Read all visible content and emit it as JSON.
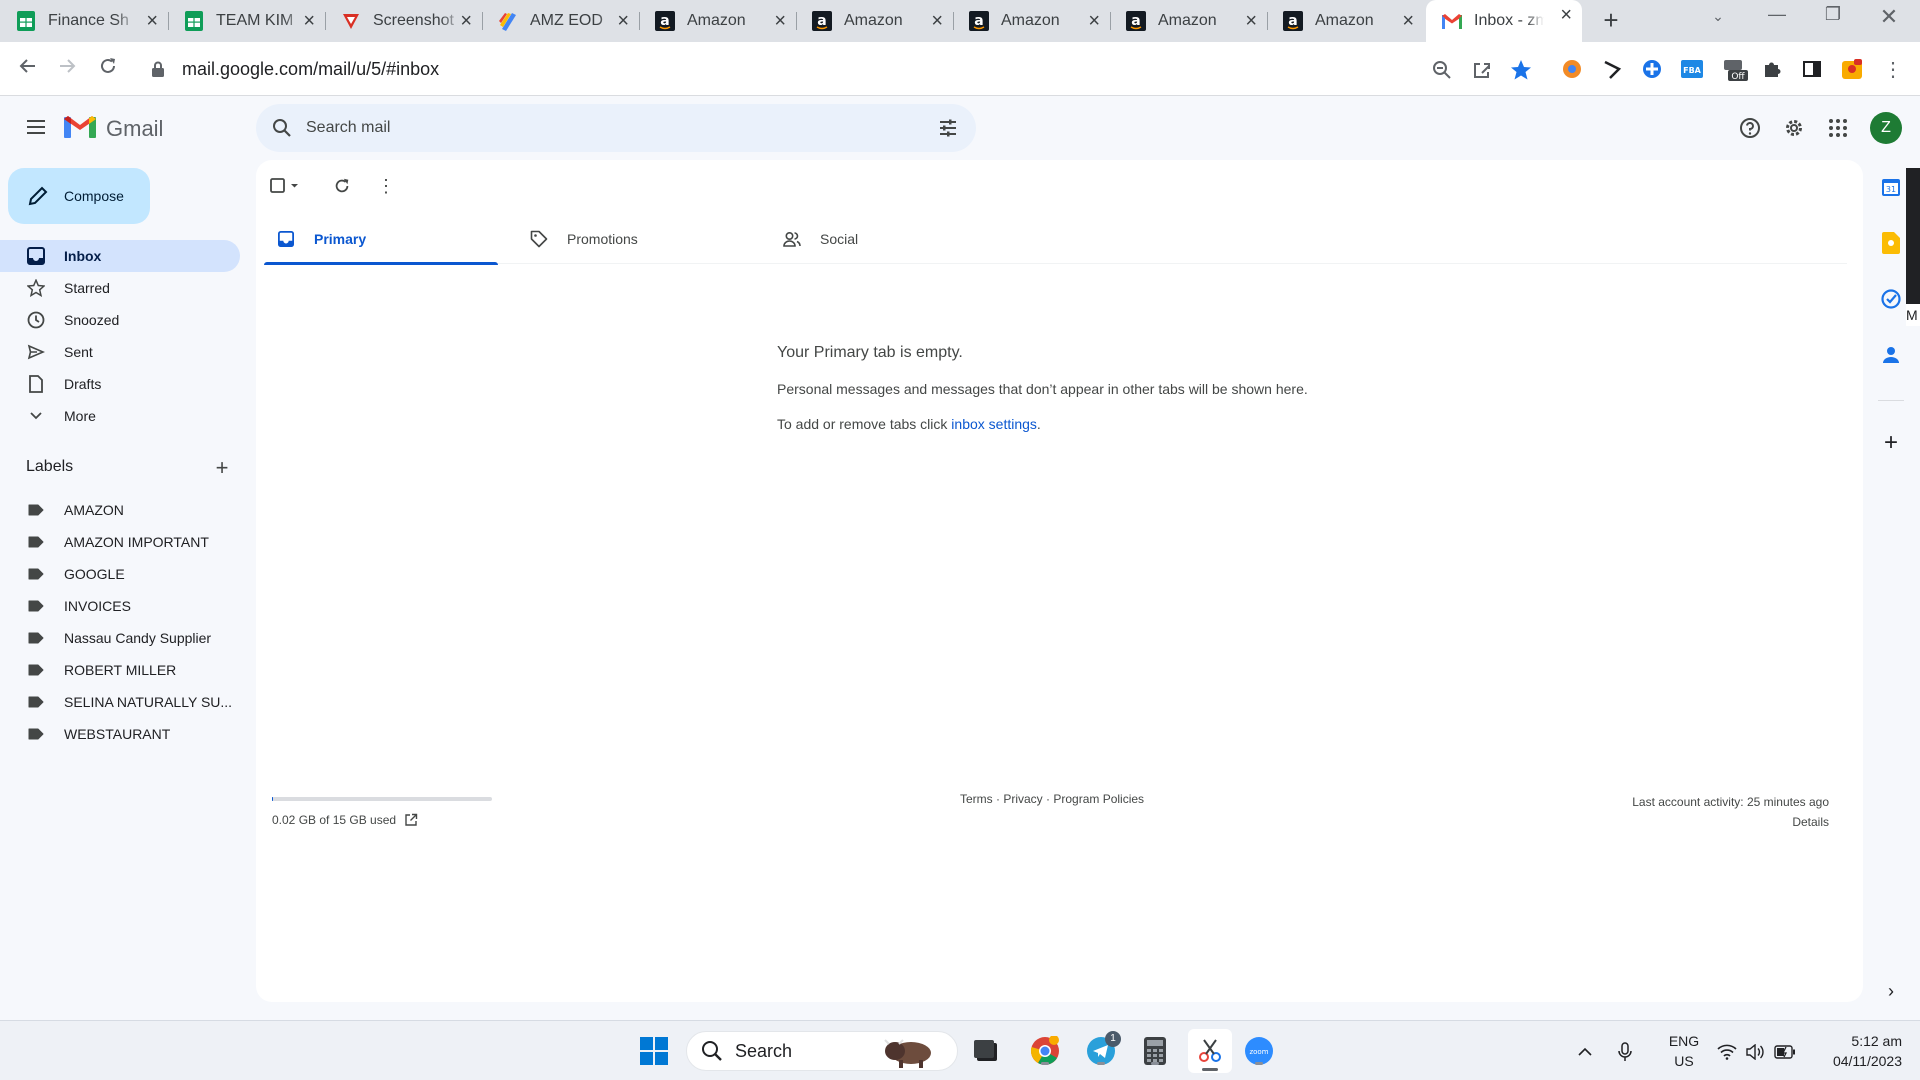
{
  "browser": {
    "tabs": [
      {
        "title": "Finance Sh",
        "favicon": "sheets-icon"
      },
      {
        "title": "TEAM KIM",
        "favicon": "sheets-icon"
      },
      {
        "title": "Screenshot",
        "favicon": "screenshot-icon"
      },
      {
        "title": "AMZ EOD",
        "favicon": "colorful-icon"
      },
      {
        "title": "Amazon",
        "favicon": "amazon-icon"
      },
      {
        "title": "Amazon",
        "favicon": "amazon-icon"
      },
      {
        "title": "Amazon",
        "favicon": "amazon-icon"
      },
      {
        "title": "Amazon",
        "favicon": "amazon-icon"
      },
      {
        "title": "Amazon",
        "favicon": "amazon-icon"
      },
      {
        "title": "Inbox - zm",
        "favicon": "gmail-icon"
      }
    ],
    "url": "mail.google.com/mail/u/5/#inbox",
    "extension_badge": "Off"
  },
  "gmail": {
    "product_name": "Gmail",
    "search_placeholder": "Search mail",
    "avatar_initial": "Z",
    "compose_label": "Compose",
    "nav": [
      {
        "label": "Inbox",
        "icon": "inbox-icon",
        "active": true
      },
      {
        "label": "Starred",
        "icon": "star-icon"
      },
      {
        "label": "Snoozed",
        "icon": "clock-icon"
      },
      {
        "label": "Sent",
        "icon": "send-icon"
      },
      {
        "label": "Drafts",
        "icon": "draft-icon"
      },
      {
        "label": "More",
        "icon": "chevron-down-icon"
      }
    ],
    "labels_header": "Labels",
    "labels": [
      "AMAZON",
      "AMAZON IMPORTANT",
      "GOOGLE",
      "INVOICES",
      "Nassau Candy Supplier",
      "ROBERT MILLER",
      "SELINA NATURALLY SU...",
      "WEBSTAURANT"
    ],
    "category_tabs": [
      {
        "label": "Primary",
        "icon": "inbox-icon",
        "active": true
      },
      {
        "label": "Promotions",
        "icon": "tag-icon"
      },
      {
        "label": "Social",
        "icon": "people-icon"
      }
    ],
    "empty_state": {
      "title": "Your Primary tab is empty.",
      "description": "Personal messages and messages that don’t appear in other tabs will be shown here.",
      "hint_prefix": "To add or remove tabs click ",
      "hint_link": "inbox settings",
      "hint_suffix": "."
    },
    "footer": {
      "storage_text": "0.02 GB of 15 GB used",
      "storage_fraction": 0.0013,
      "links": [
        "Terms",
        "Privacy",
        "Program Policies"
      ],
      "separator": " · ",
      "last_activity": "Last account activity: 25 minutes ago",
      "details": "Details"
    },
    "side_panel_edge": "M"
  },
  "taskbar": {
    "search_label": "Search",
    "telegram_badge": "1",
    "language": "ENG",
    "region": "US",
    "time": "5:12 am",
    "date": "04/11/2023"
  },
  "colors": {
    "accent": "#0b57d0",
    "compose_bg": "#c2e7ff",
    "nav_active_bg": "#d3e3fd",
    "search_bg": "#eaf1fb",
    "avatar": "#1e7b34"
  }
}
